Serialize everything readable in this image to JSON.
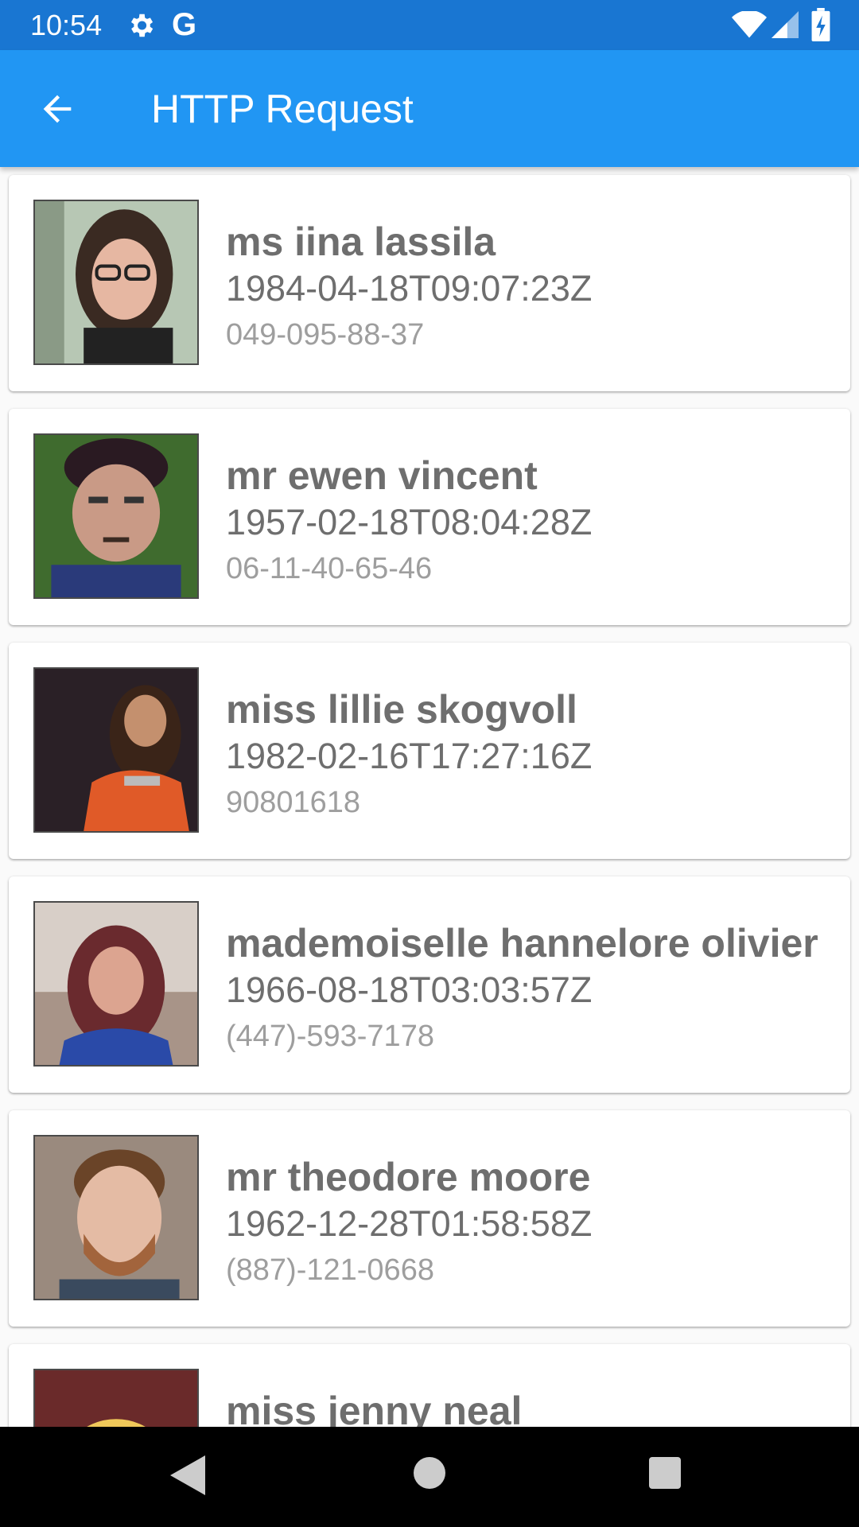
{
  "status_bar": {
    "time": "10:54",
    "g_label": "G",
    "icons": [
      "gear-icon",
      "wifi-icon",
      "signal-icon",
      "battery-charging-icon"
    ]
  },
  "app_bar": {
    "title": "HTTP Request",
    "back_icon": "arrow-left-icon",
    "background_color": "#2196f3",
    "status_bar_color": "#1976d2"
  },
  "people": [
    {
      "name": "ms iina lassila",
      "dob": "1984-04-18T09:07:23Z",
      "phone": "049-095-88-37"
    },
    {
      "name": "mr ewen vincent",
      "dob": "1957-02-18T08:04:28Z",
      "phone": "06-11-40-65-46"
    },
    {
      "name": "miss lillie skogvoll",
      "dob": "1982-02-16T17:27:16Z",
      "phone": "90801618"
    },
    {
      "name": "mademoiselle hannelore olivier",
      "dob": "1966-08-18T03:03:57Z",
      "phone": "(447)-593-7178"
    },
    {
      "name": "mr theodore moore",
      "dob": "1962-12-28T01:58:58Z",
      "phone": "(887)-121-0668"
    },
    {
      "name": "miss jenny neal"
    }
  ],
  "nav_bar": {
    "icons": [
      "back-triangle-icon",
      "home-circle-icon",
      "recents-square-icon"
    ]
  }
}
